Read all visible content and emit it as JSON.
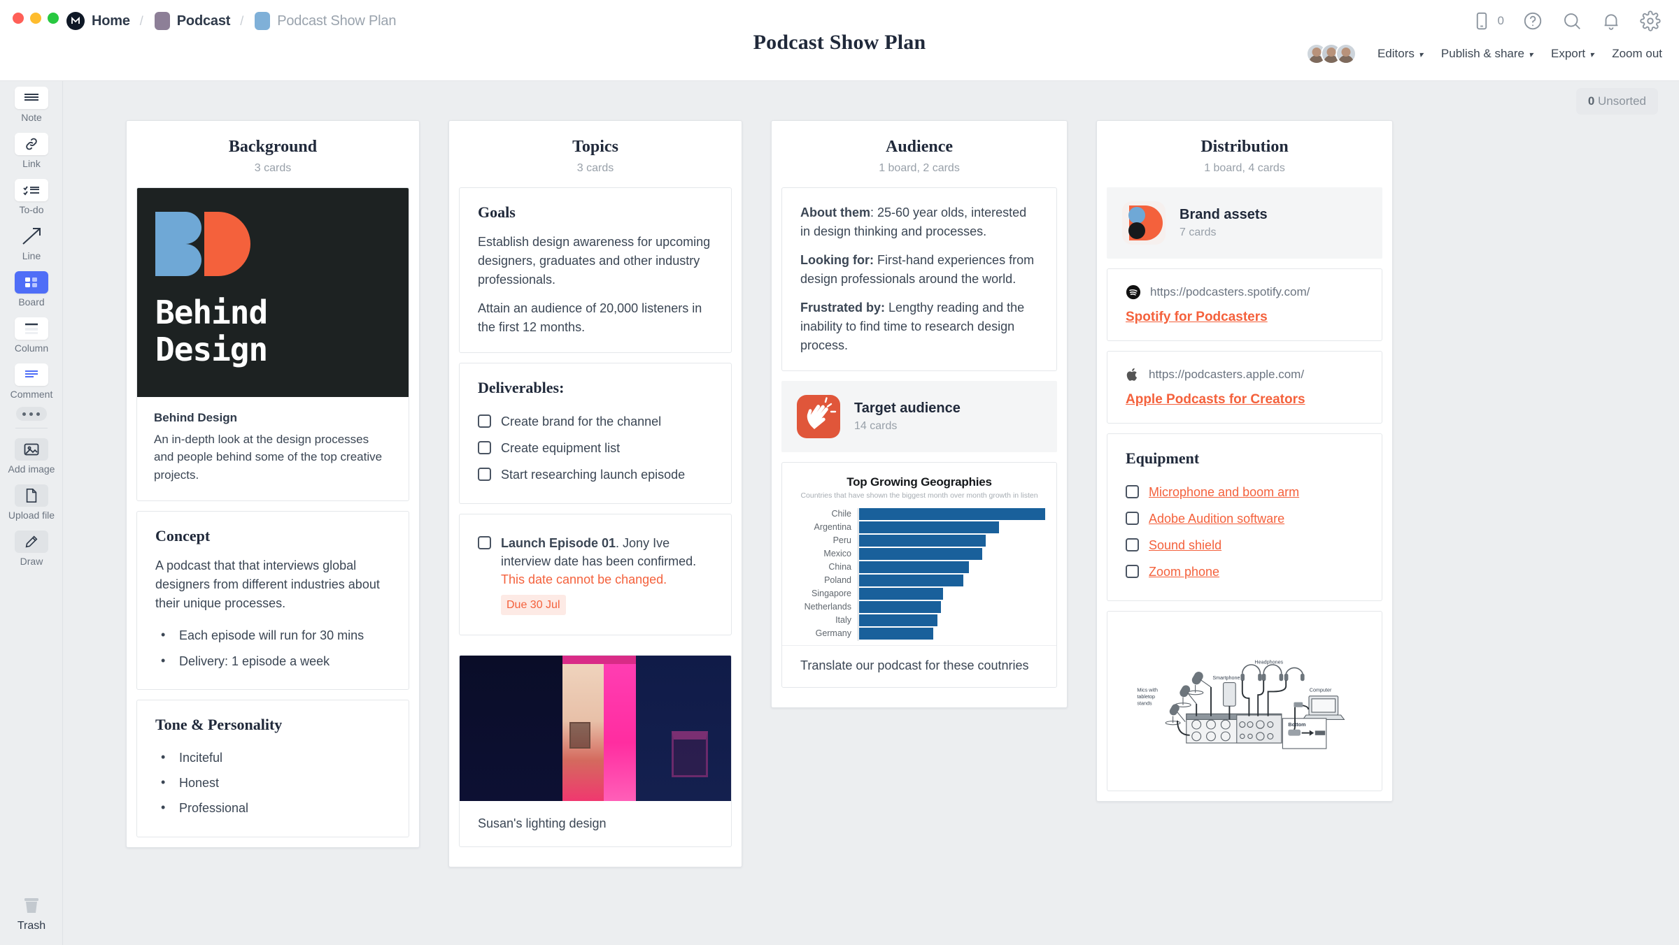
{
  "window": {
    "breadcrumb": [
      {
        "label": "Home",
        "icon": "milanote-logo-icon",
        "muted": false
      },
      {
        "label": "Podcast",
        "icon": "folder-purple-icon",
        "muted": false
      },
      {
        "label": "Podcast Show Plan",
        "icon": "board-blue-icon",
        "muted": true
      }
    ],
    "doc_title": "Podcast Show Plan"
  },
  "header": {
    "mobile_count": "0",
    "icons": [
      "mobile-icon",
      "help-icon",
      "search-icon",
      "notification-icon",
      "settings-icon"
    ],
    "menus": [
      {
        "label": "Editors",
        "caret": "⌄"
      },
      {
        "label": "Publish & share",
        "caret": "⌄"
      },
      {
        "label": "Export",
        "caret": "⌄"
      },
      {
        "label": "Zoom out",
        "caret": ""
      }
    ]
  },
  "sidebar": {
    "items": [
      {
        "label": "Note",
        "icon": "note-icon"
      },
      {
        "label": "Link",
        "icon": "link-icon"
      },
      {
        "label": "To-do",
        "icon": "todo-icon"
      },
      {
        "label": "Line",
        "icon": "line-icon"
      },
      {
        "label": "Board",
        "icon": "board-icon"
      },
      {
        "label": "Column",
        "icon": "column-icon"
      },
      {
        "label": "Comment",
        "icon": "comment-icon"
      }
    ],
    "more_label": "more-options",
    "file_items": [
      {
        "label": "Add image",
        "icon": "add-image-icon"
      },
      {
        "label": "Upload file",
        "icon": "upload-file-icon"
      },
      {
        "label": "Draw",
        "icon": "draw-icon"
      }
    ],
    "trash": {
      "label": "Trash",
      "icon": "trash-icon"
    }
  },
  "canvas": {
    "unsorted_count": "0",
    "unsorted_label": "Unsorted"
  },
  "columns": {
    "background": {
      "title": "Background",
      "subtitle": "3 cards",
      "logo": {
        "line1": "Behind",
        "line2": "Design"
      },
      "brand_card": {
        "heading": "Behind Design",
        "body": "An in-depth look at the design processes and people behind some of the top creative projects."
      },
      "concept_card": {
        "heading": "Concept",
        "body": "A podcast that that interviews global designers from different industries about their unique processes.",
        "bullets": [
          "Each episode will run for 30 mins",
          "Delivery: 1 episode a week"
        ]
      },
      "tone_card": {
        "heading": "Tone & Personality",
        "bullets": [
          "Inciteful",
          "Honest",
          "Professional"
        ]
      }
    },
    "topics": {
      "title": "Topics",
      "subtitle": "3 cards",
      "goals_card": {
        "heading": "Goals",
        "p1": "Establish design awareness for upcoming designers, graduates and other industry professionals.",
        "p2": "Attain an audience of 20,000 listeners in the first 12 months."
      },
      "deliverables_card": {
        "heading": "Deliverables:",
        "items": [
          {
            "label": "Create brand for the channel",
            "checked": false
          },
          {
            "label": "Create equipment list",
            "checked": false
          },
          {
            "label": "Start researching launch episode",
            "checked": false
          }
        ]
      },
      "launch_card": {
        "bold_part": "Launch Episode 01",
        "normal_part": ". Jony Ive interview date has been confirmed. ",
        "warning_part": "This date cannot be changed.",
        "due_badge": "Due 30 Jul",
        "checked": false
      },
      "photo_card": {
        "caption": "Susan's lighting design"
      }
    },
    "audience": {
      "title": "Audience",
      "subtitle": "1 board, 2 cards",
      "about_card": {
        "l1_bold": "About them",
        "l1_rest": ": 25-60 year olds, interested in design thinking and processes.",
        "l2_bold": "Looking for:",
        "l2_rest": " First-hand experiences from design professionals around the world.",
        "l3_bold": "Frustrated by:",
        "l3_rest": " Lengthy reading and the inability to find time to research design process."
      },
      "board_tile": {
        "name": "Target audience",
        "count": "14 cards",
        "icon": "clapping-hands-icon",
        "color": "#e0563a"
      },
      "chart_note": "Translate our podcast for these coutnries"
    },
    "distribution": {
      "title": "Distribution",
      "subtitle": "1 board, 4 cards",
      "board_tile": {
        "name": "Brand assets",
        "count": "7 cards",
        "icon": "behind-design-mark-icon"
      },
      "links": [
        {
          "icon": "spotify-icon",
          "url": "https://podcasters.spotify.com/",
          "label": "Spotify for Podcasters"
        },
        {
          "icon": "apple-icon",
          "url": "https://podcasters.apple.com/",
          "label": "Apple Podcasts for Creators"
        }
      ],
      "equipment_card": {
        "heading": "Equipment",
        "items": [
          {
            "label": "Microphone and boom arm",
            "checked": false
          },
          {
            "label": "Adobe Audition software",
            "checked": false
          },
          {
            "label": "Sound shield",
            "checked": false
          },
          {
            "label": "Zoom phone",
            "checked": false
          }
        ]
      },
      "diagram_labels": {
        "mics": "Mics with tabletop stands",
        "smartphone": "Smartphone",
        "headphones": "Headphones",
        "computer": "Computer",
        "bottom": "Bottom"
      }
    }
  },
  "chart_data": {
    "type": "bar",
    "orientation": "horizontal",
    "title": "Top Growing Geographies",
    "subtitle": "Countries that have shown the biggest month over month growth in listen",
    "xlabel": "",
    "ylabel": "",
    "grid": false,
    "legend": null,
    "bar_color": "#19609b",
    "categories": [
      "Chile",
      "Argentina",
      "Peru",
      "Mexico",
      "China",
      "Poland",
      "Singapore",
      "Netherlands",
      "Italy",
      "Germany"
    ],
    "values": [
      100,
      75,
      68,
      66,
      59,
      56,
      45,
      44,
      42,
      40
    ],
    "value_unit": "relative % of max",
    "xlim": [
      0,
      100
    ]
  },
  "colors": {
    "accent_orange": "#f4613c",
    "brand_blue": "#6fa8d6",
    "brand_dark": "#1d2222",
    "chart_blue": "#19609b",
    "tool_active": "#4f6ef7"
  }
}
